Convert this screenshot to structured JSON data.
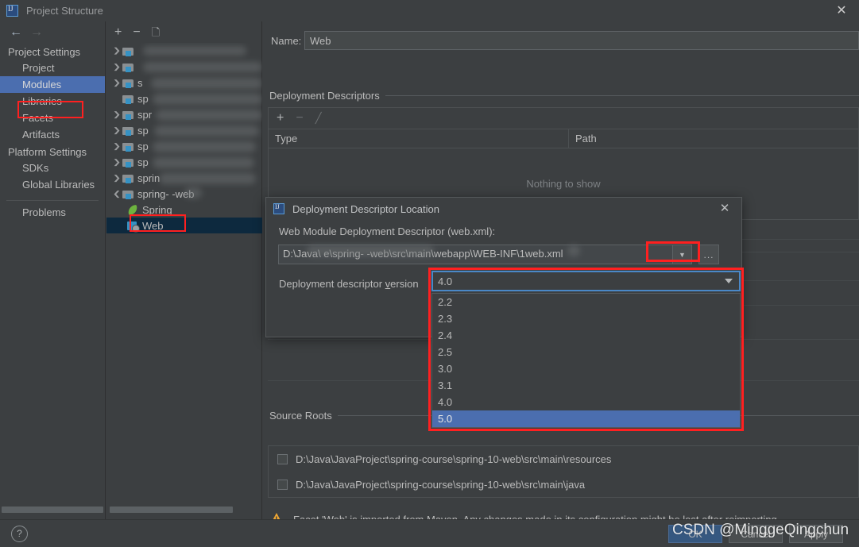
{
  "window": {
    "title": "Project Structure",
    "logo_icon": "intellij-idea-logo-icon",
    "close_icon": "close-icon"
  },
  "nav": {
    "back_icon": "arrow-left-icon",
    "forward_icon": "arrow-right-icon"
  },
  "sidebar": {
    "groups": [
      {
        "label": "Project Settings",
        "items": [
          {
            "label": "Project",
            "selected": false
          },
          {
            "label": "Modules",
            "selected": true
          },
          {
            "label": "Libraries",
            "selected": false
          },
          {
            "label": "Facets",
            "selected": false
          },
          {
            "label": "Artifacts",
            "selected": false
          }
        ]
      },
      {
        "label": "Platform Settings",
        "items": [
          {
            "label": "SDKs",
            "selected": false
          },
          {
            "label": "Global Libraries",
            "selected": false
          }
        ]
      }
    ],
    "problems": {
      "label": "Problems"
    },
    "highlight_color": "#ff2020",
    "selected_color": "#4b6eaf"
  },
  "tree_toolbar": {
    "add_icon": "plus-icon",
    "remove_icon": "minus-icon",
    "copy_icon": "copy-icon"
  },
  "tree": {
    "rows": [
      {
        "label": "",
        "blurred": true,
        "twisty": "collapsed",
        "icon": "module-folder-icon",
        "indent": 0
      },
      {
        "label": "",
        "blurred": true,
        "twisty": "collapsed",
        "icon": "module-folder-icon",
        "indent": 0
      },
      {
        "label": "s",
        "blurred": true,
        "twisty": "collapsed",
        "icon": "module-folder-icon",
        "indent": 0
      },
      {
        "label": "sp",
        "blurred": true,
        "twisty": "none",
        "icon": "module-folder-icon",
        "indent": 0
      },
      {
        "label": "spr",
        "blurred": true,
        "twisty": "collapsed",
        "icon": "module-folder-icon",
        "indent": 0
      },
      {
        "label": "sp",
        "blurred": true,
        "twisty": "collapsed",
        "icon": "module-folder-icon",
        "indent": 0
      },
      {
        "label": "sp",
        "blurred": true,
        "twisty": "collapsed",
        "icon": "module-folder-icon",
        "indent": 0
      },
      {
        "label": "sp",
        "blurred": true,
        "twisty": "collapsed",
        "icon": "module-folder-icon",
        "indent": 0
      },
      {
        "label": "sprin",
        "blurred": true,
        "twisty": "collapsed",
        "icon": "module-folder-icon",
        "indent": 0
      },
      {
        "label": "spring-  -web",
        "blurred": false,
        "twisty": "expanded",
        "icon": "module-folder-icon",
        "indent": 0
      },
      {
        "label": "Spring",
        "blurred": false,
        "twisty": "none",
        "icon": "spring-leaf-icon",
        "indent": 1
      },
      {
        "label": "Web",
        "blurred": false,
        "twisty": "none",
        "icon": "web-facet-icon",
        "indent": 1,
        "selected": true
      }
    ],
    "blurred_extra_text": [
      "c",
      "anno"
    ]
  },
  "main": {
    "name_label": "Name:",
    "name_value": "Web",
    "deployment_descriptors": {
      "section_title": "Deployment Descriptors",
      "toolbar": {
        "add_icon": "plus-icon",
        "remove_icon": "minus-icon",
        "edit_icon": "pencil-icon"
      },
      "columns": [
        "Type",
        "Path"
      ],
      "empty_text": "Nothing to show",
      "rows": []
    },
    "source_roots": {
      "section_title": "Source Roots",
      "rows": [
        {
          "checked": false,
          "path": "D:\\Java\\JavaProject\\spring-course\\spring-10-web\\src\\main\\resources"
        },
        {
          "checked": false,
          "path": "D:\\Java\\JavaProject\\spring-course\\spring-10-web\\src\\main\\java"
        }
      ]
    },
    "warning": {
      "icon": "warning-triangle-icon",
      "text": "Facet 'Web' is imported from Maven. Any changes made in its configuration might be lost after reimporting.",
      "color": "#f0a732"
    }
  },
  "dialog": {
    "logo_icon": "intellij-idea-logo-icon",
    "title": "Deployment Descriptor Location",
    "close_icon": "close-icon",
    "descriptor_label": "Web Module Deployment Descriptor (web.xml):",
    "path_value": "D:\\Java\\                    e\\spring-  -web\\src\\main\\webapp\\WEB-INF\\1web.xml",
    "path_highlight_text": "1web.xml",
    "path_dropdown_icon": "chevron-down-icon",
    "browse_label": "...",
    "version_label_pre": "Deployment descriptor ",
    "version_label_accel": "v",
    "version_label_post": "ersion",
    "combo": {
      "value": "4.0",
      "arrow_icon": "chevron-down-icon",
      "options": [
        "2.2",
        "2.3",
        "2.4",
        "2.5",
        "3.0",
        "3.1",
        "4.0",
        "5.0"
      ],
      "highlighted_option": "5.0"
    },
    "highlight_color": "#ff2020",
    "focus_color": "#4a88c7"
  },
  "bottom": {
    "help_label": "?",
    "help_icon": "help-question-icon",
    "ok_label": "OK",
    "cancel_label": "Cancel",
    "apply_label": "Apply",
    "ok_color": "#365880"
  },
  "watermark": {
    "text": "CSDN @MinggeQingchun"
  }
}
